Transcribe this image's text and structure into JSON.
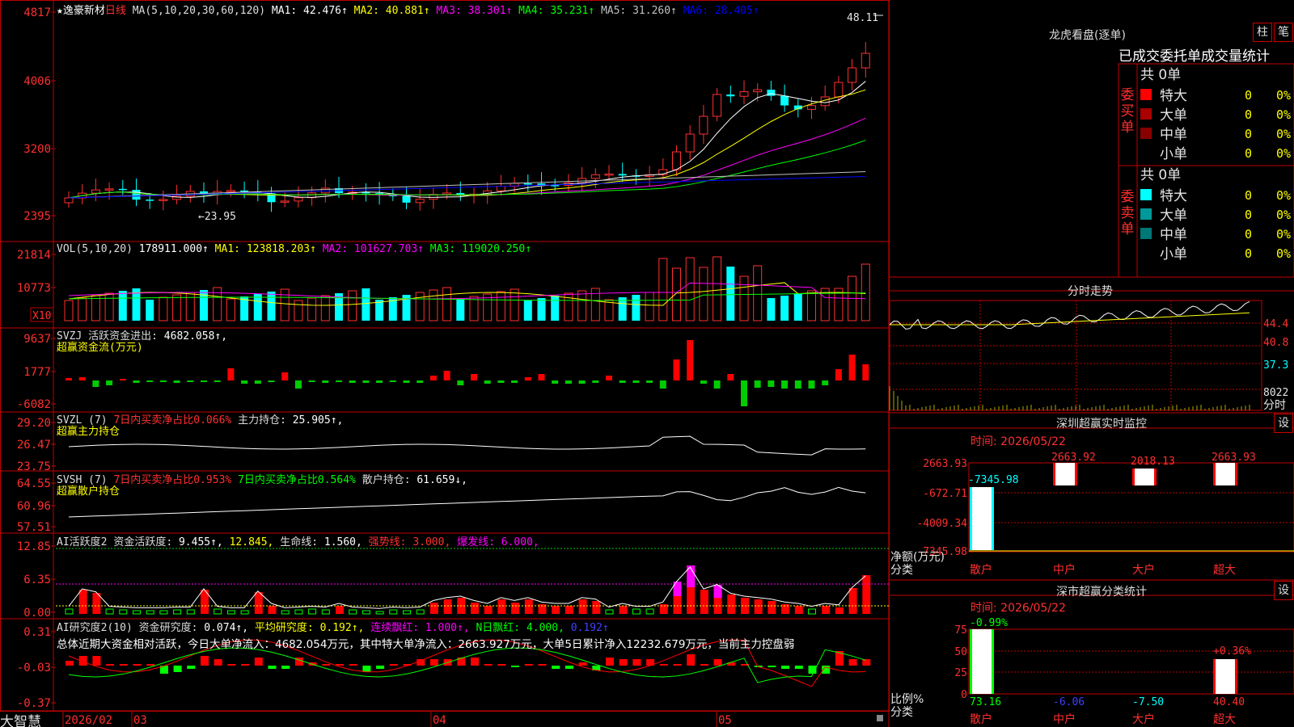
{
  "chart": {
    "symbol_star": "★",
    "stock_name": "逸豪新材",
    "period": "日线",
    "ma_param": "MA(5,10,20,30,60,120)",
    "ma_values": [
      {
        "label": "MA1:",
        "value": "42.476↑",
        "color": "#ffffff"
      },
      {
        "label": "MA2:",
        "value": "40.881↑",
        "color": "#ffff00"
      },
      {
        "label": "MA3:",
        "value": "38.301↑",
        "color": "#ff00ff"
      },
      {
        "label": "MA4:",
        "value": "35.231↑",
        "color": "#00ff00"
      },
      {
        "label": "MA5:",
        "value": "31.260↑",
        "color": "#c0c0c0"
      },
      {
        "label": "MA6:",
        "value": "28.405↑",
        "color": "#0000ff"
      }
    ],
    "y_labels": [
      "4817",
      "4006",
      "3200",
      "2395"
    ],
    "high_marker": "48.11",
    "low_marker": "←23.95",
    "x_labels": [
      "2026/02",
      "03",
      "04",
      "05"
    ],
    "footer_logo": "大智慧"
  },
  "volume": {
    "title": "VOL(5,10,20)",
    "value": "178911.000↑",
    "ma": [
      {
        "label": "MA1:",
        "value": "123818.203↑",
        "color": "#ffff00"
      },
      {
        "label": "MA2:",
        "value": "101627.703↑",
        "color": "#ff00ff"
      },
      {
        "label": "MA3:",
        "value": "119020.250↑",
        "color": "#00ff00"
      }
    ],
    "y_labels": [
      "21814",
      "10773"
    ],
    "unit_badge": "X10"
  },
  "svzj": {
    "title": "SVZJ",
    "label": "活跃资金进出:",
    "value": "4682.058↑,",
    "subtitle": "超赢资金流(万元)",
    "y_labels": [
      "9637",
      "1777",
      "-6082"
    ]
  },
  "svzl": {
    "title": "SVZL (7)",
    "label1": "7日内买卖净占比0.066%",
    "label2": "主力持仓:",
    "value2": "25.905↑,",
    "subtitle": "超赢主力持仓",
    "y_labels": [
      "29.20",
      "26.47",
      "23.75"
    ]
  },
  "svsh": {
    "title": "SVSH (7)",
    "label1": "7日内买卖净占比0.953%",
    "label2": "7日内买卖净占比0.564%",
    "label3": "散户持仓:",
    "value3": "61.659↓,",
    "subtitle": "超赢散户持仓",
    "y_labels": [
      "64.55",
      "60.96",
      "57.51"
    ]
  },
  "ai1": {
    "title": "AI活跃度2",
    "label1": "资金活跃度:",
    "value1": "9.455↑,",
    "value2": "12.845,",
    "label3": "生命线:",
    "value3": "1.560,",
    "label4": "强势线:",
    "value4": "3.000,",
    "label5": "爆发线:",
    "value5": "6.000,",
    "y_labels": [
      "12.85",
      "6.35",
      "0.00"
    ]
  },
  "ai2": {
    "title": "AI研究度2(10)",
    "label1": "资金研究度:",
    "value1": "0.074↑,",
    "label2": "平均研究度:",
    "value2": "0.192↑,",
    "label3": "连续飘红:",
    "value3": "1.000↑,",
    "label4": "N日飘红:",
    "value4": "4.000,",
    "value5": "0.192↑",
    "summary": "总体近期大资金相对活跃，今日大单净流入：4682.054万元，其中特大单净流入：2663.927万元，大单5日累计净入12232.679万元，当前主力控盘弱",
    "y_labels": [
      "0.31",
      "-0.03",
      "-0.37"
    ]
  },
  "dragon": {
    "title": "龙虎看盘(逐单)",
    "btn1": "柱",
    "btn2": "笔",
    "tabs": "已成交委托单成交量统计",
    "buy_label": [
      "委",
      "买",
      "单"
    ],
    "sell_label": [
      "委",
      "卖",
      "单"
    ],
    "buy_total": "共 0单",
    "sell_total": "共 0单",
    "rows": [
      {
        "name": "特大",
        "count": "0",
        "pct": "0%"
      },
      {
        "name": "大单",
        "count": "0",
        "pct": "0%"
      },
      {
        "name": "中单",
        "count": "0",
        "pct": "0%"
      },
      {
        "name": "小单",
        "count": "0",
        "pct": "0%"
      }
    ],
    "buy_colors": [
      "#ff0000",
      "#aa0000",
      "#880000",
      ""
    ],
    "sell_colors": [
      "#00ffff",
      "#009999",
      "#007777",
      ""
    ]
  },
  "intraday": {
    "title": "分时走势",
    "y_labels": [
      "44.4",
      "40.8",
      "37.3",
      "8022"
    ],
    "foot": "分时"
  },
  "sz_monitor": {
    "title": "深圳超赢实时监控",
    "btn": "设",
    "time": "时间: 2026/05/22",
    "y_labels": [
      "2663.93",
      "-672.71",
      "-4009.34",
      "-7345.98"
    ],
    "bar_labels": [
      "-7345.98",
      "2663.92",
      "2018.13",
      "2663.93"
    ],
    "axis_title": [
      "净额(万元)",
      "分类"
    ],
    "categories": [
      "散户",
      "中户",
      "大户",
      "超大"
    ]
  },
  "sz_stats": {
    "title": "深市超赢分类统计",
    "btn": "设",
    "time": "时间: 2026/05/22",
    "y_labels": [
      "75",
      "50",
      "25",
      "0"
    ],
    "top_labels": [
      "-0.99%",
      "",
      "",
      "+0.36%"
    ],
    "values": [
      "73.16",
      "-6.06",
      "-7.50",
      "40.40"
    ],
    "axis_title": [
      "比例%",
      "分类"
    ],
    "categories": [
      "散户",
      "中户",
      "大户",
      "超大"
    ]
  }
}
